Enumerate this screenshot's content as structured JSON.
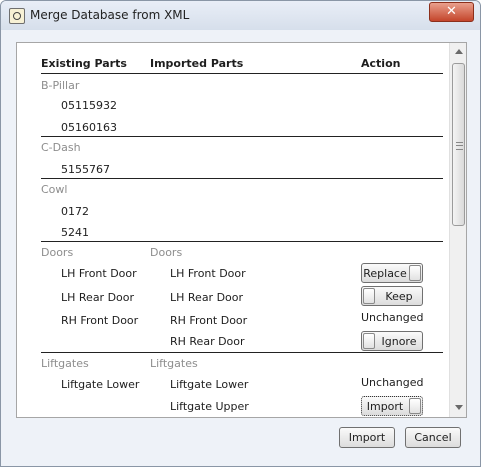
{
  "window": {
    "title": "Merge Database from XML",
    "close_glyph": "✕"
  },
  "table": {
    "headers": {
      "existing": "Existing Parts",
      "imported": "Imported Parts",
      "action": "Action"
    },
    "groups": {
      "bpillar": {
        "existing": "B-Pillar",
        "rows": [
          "05115932",
          "05160163"
        ]
      },
      "cdash": {
        "existing": "C-Dash",
        "rows": [
          "5155767"
        ]
      },
      "cowl": {
        "existing": "Cowl",
        "rows": [
          "0172",
          "5241"
        ]
      },
      "doors": {
        "existing": "Doors",
        "imported": "Doors",
        "rows": [
          {
            "existing": "LH Front Door",
            "imported": "LH Front Door",
            "action": "Replace"
          },
          {
            "existing": "LH Rear Door",
            "imported": "LH Rear Door",
            "action": "Keep"
          },
          {
            "existing": "RH Front Door",
            "imported": "RH Front Door",
            "action": "Unchanged"
          },
          {
            "existing": "",
            "imported": "RH Rear Door",
            "action": "Ignore"
          }
        ]
      },
      "liftgates": {
        "existing": "Liftgates",
        "imported": "Liftgates",
        "rows": [
          {
            "existing": "Liftgate Lower",
            "imported": "Liftgate Lower",
            "action": "Unchanged"
          },
          {
            "existing": "",
            "imported": "Liftgate Upper",
            "action": "Import"
          }
        ]
      }
    }
  },
  "footer": {
    "import_label": "Import",
    "cancel_label": "Cancel"
  }
}
